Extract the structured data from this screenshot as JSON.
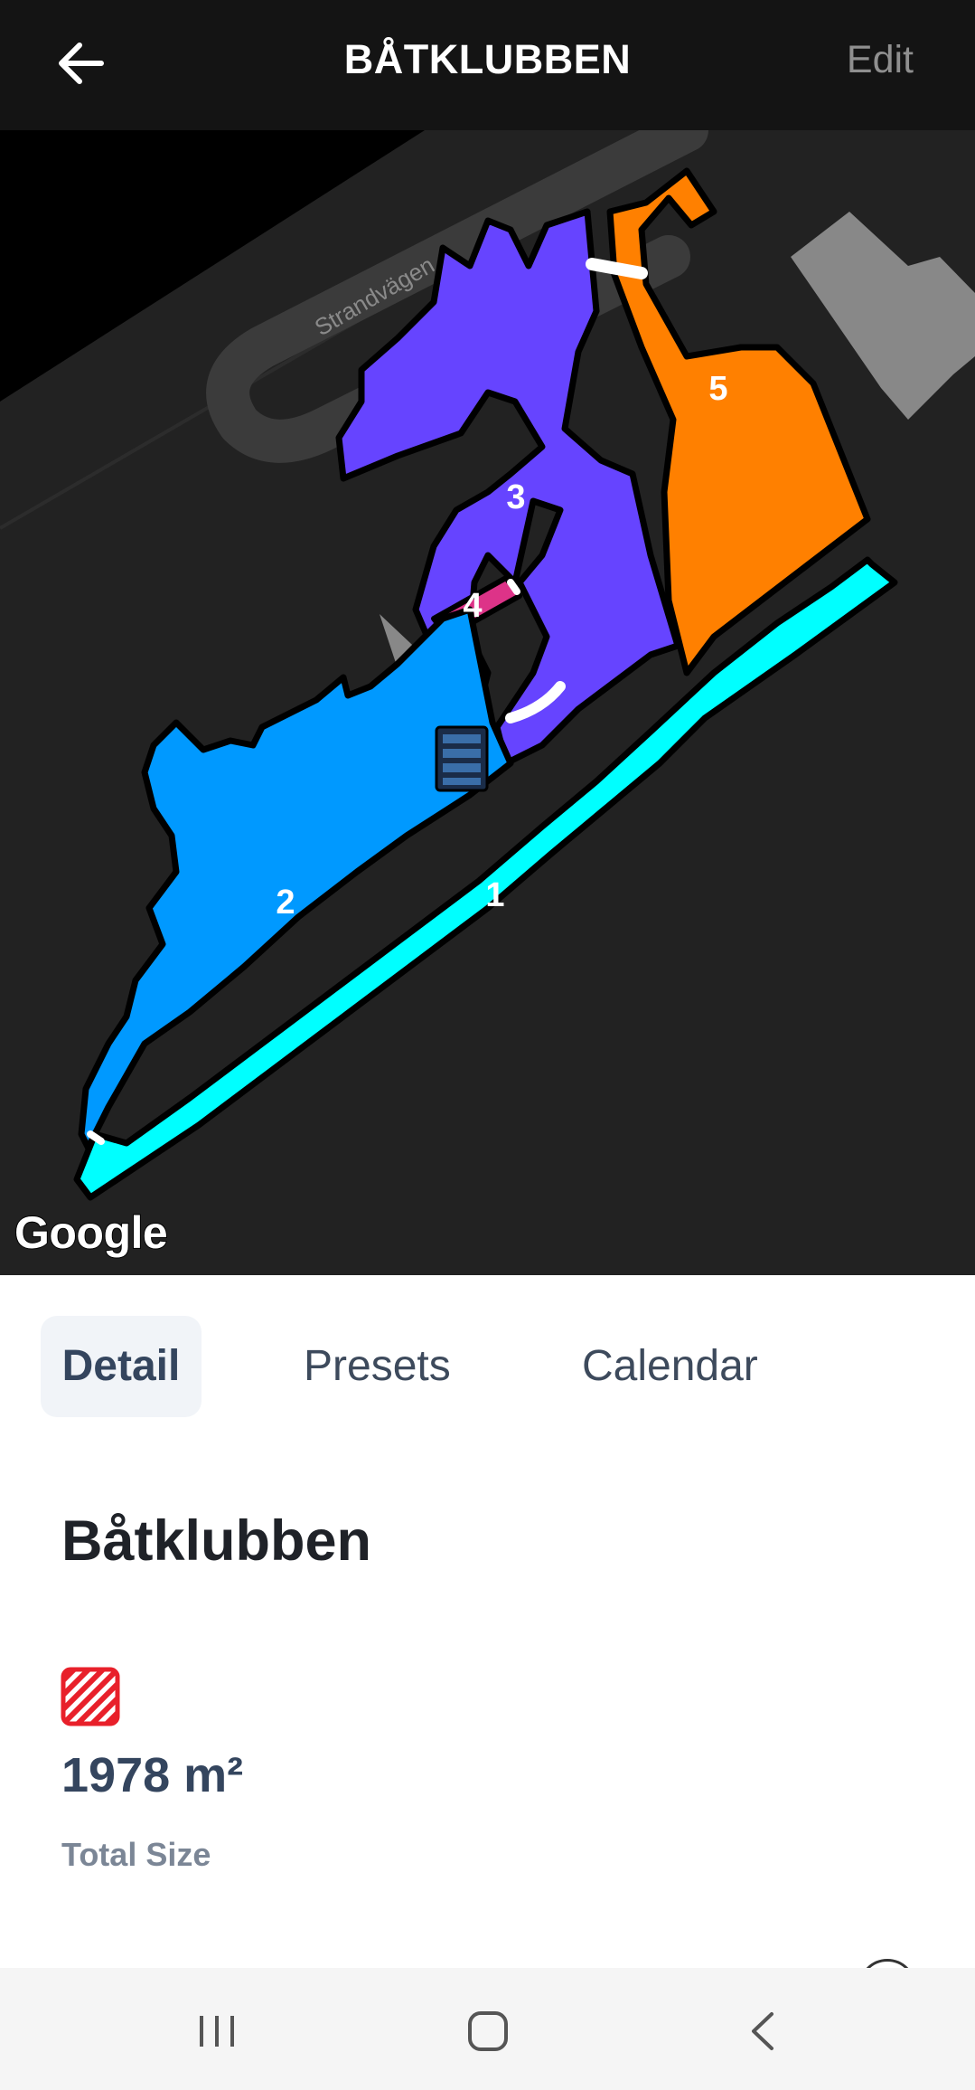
{
  "header": {
    "title": "BÅTKLUBBEN",
    "edit_label": "Edit",
    "back_icon": "arrow-left-icon"
  },
  "map": {
    "road_label": "Strandvägen",
    "attribution": "Google",
    "zones": [
      {
        "label": "1",
        "color": "#00FFFF"
      },
      {
        "label": "2",
        "color": "#0099FF"
      },
      {
        "label": "3",
        "color": "#6644FF"
      },
      {
        "label": "4",
        "color": "#DD3388"
      },
      {
        "label": "5",
        "color": "#FF8000"
      }
    ],
    "marker_icon": "robot-mower-dock-icon"
  },
  "tabs": [
    {
      "label": "Detail",
      "active": true
    },
    {
      "label": "Presets",
      "active": false
    },
    {
      "label": "Calendar",
      "active": false
    }
  ],
  "detail": {
    "title": "Båtklubben",
    "icon": "striped-zone-icon",
    "icon_color": "#E8202A",
    "size_value": "1978 m²",
    "size_label": "Total Size"
  },
  "system_nav": {
    "recents_icon": "recents-icon",
    "home_icon": "home-icon",
    "back_icon": "chevron-left-icon"
  }
}
